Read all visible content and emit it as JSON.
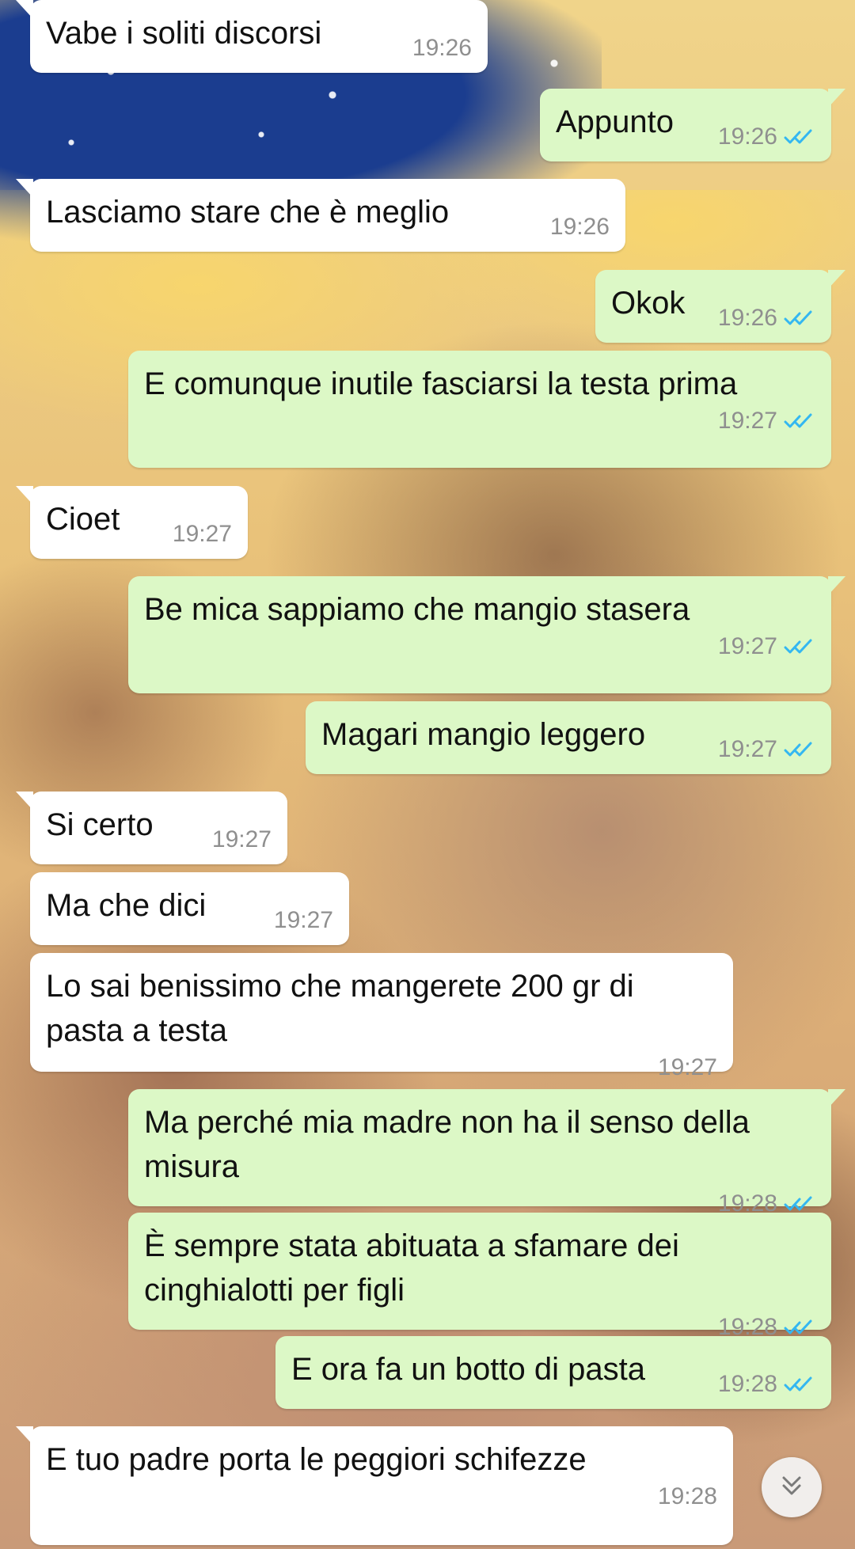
{
  "messages": [
    {
      "id": "m1",
      "direction": "in",
      "text": "Vabe i soliti discorsi",
      "time": "19:26"
    },
    {
      "id": "m2",
      "direction": "out",
      "text": "Appunto",
      "time": "19:26",
      "read": true
    },
    {
      "id": "m3",
      "direction": "in",
      "text": "Lasciamo stare che è meglio",
      "time": "19:26"
    },
    {
      "id": "m4",
      "direction": "out",
      "text": "Okok",
      "time": "19:26",
      "read": true
    },
    {
      "id": "m5",
      "direction": "out",
      "text": "E comunque inutile fasciarsi la testa prima",
      "time": "19:27",
      "read": true
    },
    {
      "id": "m6",
      "direction": "in",
      "text": "Cioet",
      "time": "19:27"
    },
    {
      "id": "m7",
      "direction": "out",
      "text": "Be mica sappiamo che mangio stasera",
      "time": "19:27",
      "read": true
    },
    {
      "id": "m8",
      "direction": "out",
      "text": "Magari mangio leggero",
      "time": "19:27",
      "read": true
    },
    {
      "id": "m9",
      "direction": "in",
      "text": "Si certo",
      "time": "19:27"
    },
    {
      "id": "m10",
      "direction": "in",
      "text": "Ma che dici",
      "time": "19:27"
    },
    {
      "id": "m11",
      "direction": "in",
      "text": "Lo sai benissimo che mangerete 200 gr di pasta a testa",
      "time": "19:27"
    },
    {
      "id": "m12",
      "direction": "out",
      "text": "Ma perché mia madre non ha il senso della misura",
      "time": "19:28",
      "read": true
    },
    {
      "id": "m13",
      "direction": "out",
      "text": "È sempre stata abituata a sfamare dei cinghialotti per figli",
      "time": "19:28",
      "read": true
    },
    {
      "id": "m14",
      "direction": "out",
      "text": "E ora fa un botto di pasta",
      "time": "19:28",
      "read": true
    },
    {
      "id": "m15",
      "direction": "in",
      "text": "E tuo padre porta le peggiori schifezze",
      "time": "19:28"
    }
  ],
  "icons": {
    "read_receipt": "double-check-icon",
    "scroll_down": "double-chevron-down-icon"
  },
  "colors": {
    "incoming_bubble": "#ffffff",
    "outgoing_bubble": "#dcf8c6",
    "timestamp": "#8f8f8f",
    "read_ticks": "#34b7f1"
  }
}
